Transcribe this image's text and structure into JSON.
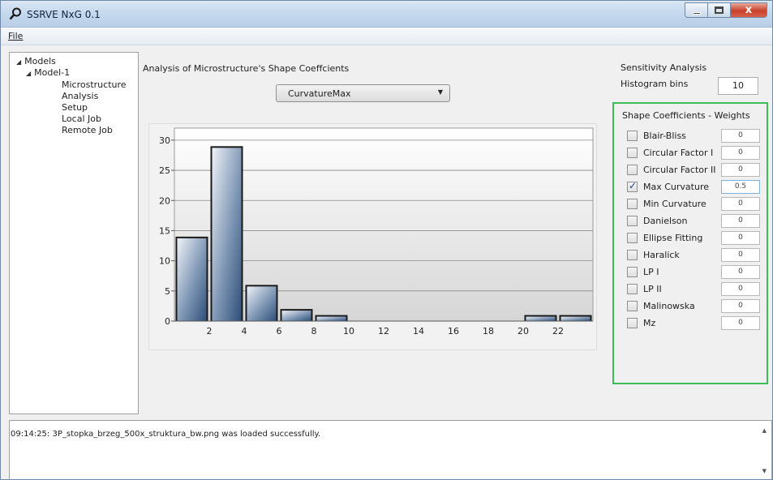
{
  "window": {
    "title": "SSRVE NxG 0.1",
    "icons": {
      "app": "magnifier-icon",
      "minimize": "minimize-icon",
      "maximize": "maximize-icon",
      "close": "close-icon"
    },
    "close_glyph": "x"
  },
  "menu": {
    "file": "File"
  },
  "tree": {
    "root": "Models",
    "model": "Model-1",
    "items": [
      "Microstructure",
      "Analysis",
      "Setup",
      "Local Job",
      "Remote Job"
    ]
  },
  "analysis": {
    "title": "Analysis of Microstructure's Shape Coeffcients",
    "selected_coefficient": "CurvatureMax"
  },
  "chart_data": {
    "type": "bar",
    "x": [
      1,
      3,
      5,
      7,
      9,
      11,
      13,
      15,
      17,
      19,
      21,
      23
    ],
    "values": [
      14,
      29,
      6,
      2,
      1,
      0,
      0,
      0,
      0,
      0,
      1,
      1
    ],
    "x_ticks": [
      "2",
      "4",
      "6",
      "8",
      "10",
      "12",
      "14",
      "16",
      "18",
      "20",
      "22"
    ],
    "y_ticks": [
      "0",
      "5",
      "10",
      "15",
      "20",
      "25",
      "30"
    ],
    "xlim": [
      0,
      24
    ],
    "ylim": [
      0,
      32
    ],
    "xlabel": "",
    "ylabel": "",
    "grid": true,
    "bar_color": "#2f4f78"
  },
  "sensitivity": {
    "title": "Sensitivity Analysis",
    "bins_label": "Histogram bins",
    "bins_value": "10"
  },
  "weights": {
    "title": "Shape Coefficients - Weights",
    "accent": "#3dbc58",
    "rows": [
      {
        "label": "Blair-Bliss",
        "value": "0",
        "checked": false
      },
      {
        "label": "Circular Factor I",
        "value": "0",
        "checked": false
      },
      {
        "label": "Circular Factor II",
        "value": "0",
        "checked": false
      },
      {
        "label": "Max Curvature",
        "value": "0.5",
        "checked": true
      },
      {
        "label": "Min Curvature",
        "value": "0",
        "checked": false
      },
      {
        "label": "Danielson",
        "value": "0",
        "checked": false
      },
      {
        "label": "Ellipse Fitting",
        "value": "0",
        "checked": false
      },
      {
        "label": "Haralick",
        "value": "0",
        "checked": false
      },
      {
        "label": "LP I",
        "value": "0",
        "checked": false
      },
      {
        "label": "LP II",
        "value": "0",
        "checked": false
      },
      {
        "label": "Malinowska",
        "value": "0",
        "checked": false
      },
      {
        "label": "Mz",
        "value": "0",
        "checked": false
      }
    ]
  },
  "log": {
    "message": "09:14:25: 3P_stopka_brzeg_500x_struktura_bw.png was loaded successfully."
  }
}
